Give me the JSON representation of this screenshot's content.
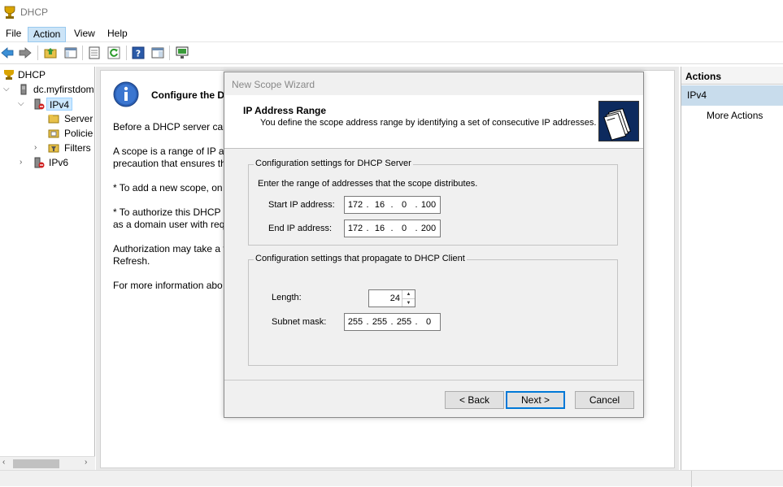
{
  "window": {
    "title": "DHCP"
  },
  "menu": {
    "items": [
      "File",
      "Action",
      "View",
      "Help"
    ],
    "active": "Action"
  },
  "tree": {
    "root": "DHCP",
    "server": "dc.myfirstdom",
    "ipv4": "IPv4",
    "server_options": "Server",
    "policies": "Policie",
    "filters": "Filters",
    "ipv6": "IPv6"
  },
  "middle": {
    "title": "Configure the D",
    "lines": [
      "Before a DHCP server can",
      "A scope is a range of IP ad",
      "precaution that ensures th",
      "* To add a new scope, on t",
      "* To authorize this DHCP s",
      "as a domain user with req",
      "Authorization may take a f",
      "Refresh.",
      "For more information abo"
    ]
  },
  "actions": {
    "header": "Actions",
    "selected": "IPv4",
    "more": "More Actions"
  },
  "wizard": {
    "title": "New Scope Wizard",
    "heading": "IP Address Range",
    "subheading": "You define the scope address range by identifying a set of consecutive IP addresses.",
    "server_group": {
      "title": "Configuration settings for DHCP Server",
      "instruction": "Enter the range of addresses that the scope distributes.",
      "start_label": "Start IP address:",
      "start_ip": [
        "172",
        "16",
        "0",
        "100"
      ],
      "end_label": "End IP address:",
      "end_ip": [
        "172",
        "16",
        "0",
        "200"
      ]
    },
    "client_group": {
      "title": "Configuration settings that propagate to DHCP Client",
      "length_label": "Length:",
      "length_value": "24",
      "mask_label": "Subnet mask:",
      "mask": [
        "255",
        "255",
        "255",
        "0"
      ]
    },
    "buttons": {
      "back": "< Back",
      "next": "Next >",
      "cancel": "Cancel"
    }
  },
  "colors": {
    "accent": "#0078d7",
    "selection": "#c8dcec",
    "menu_active": "#cce4f7"
  }
}
